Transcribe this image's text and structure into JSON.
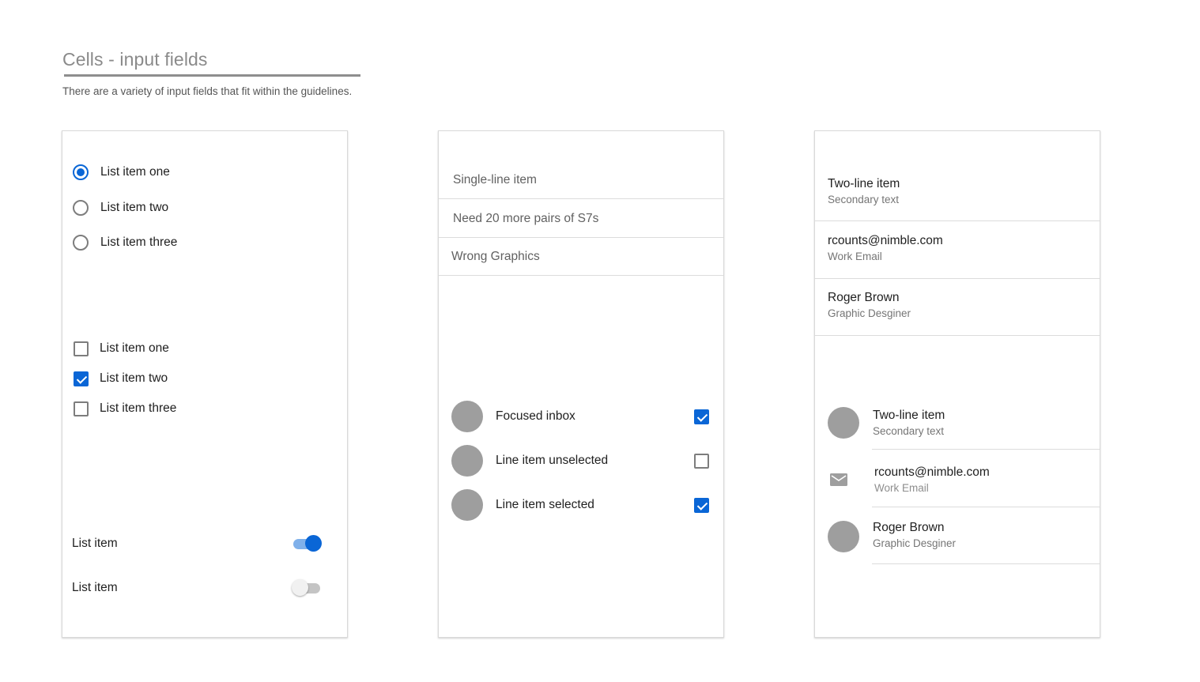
{
  "header": {
    "title": "Cells - input fields",
    "description": "There are a variety of input fields that fit within the guidelines."
  },
  "colors": {
    "accent": "#0a66d6",
    "avatar": "#9e9e9e",
    "divider": "#dcdcdc"
  },
  "card1": {
    "radios": [
      {
        "label": "List item one",
        "selected": true
      },
      {
        "label": "List item two",
        "selected": false
      },
      {
        "label": "List item three",
        "selected": false
      }
    ],
    "checkboxes": [
      {
        "label": "List item one",
        "checked": false
      },
      {
        "label": "List item two",
        "checked": true
      },
      {
        "label": "List item three",
        "checked": false
      }
    ],
    "toggles": [
      {
        "label": "List item",
        "on": true
      },
      {
        "label": "List item",
        "on": false
      }
    ]
  },
  "card2": {
    "single_line_items": [
      {
        "label": "Single-line item"
      },
      {
        "label": "Need 20 more pairs of S7s"
      },
      {
        "label": "Wrong Graphics"
      }
    ],
    "avatar_items": [
      {
        "label": "Focused inbox",
        "checked": true
      },
      {
        "label": "Line item unselected",
        "checked": false
      },
      {
        "label": "Line item selected",
        "checked": true
      }
    ]
  },
  "card3": {
    "two_line_items": [
      {
        "primary": "Two-line item",
        "secondary": "Secondary text"
      },
      {
        "primary": "rcounts@nimble.com",
        "secondary": "Work Email"
      },
      {
        "primary": "Roger Brown",
        "secondary": "Graphic Desginer"
      }
    ],
    "lead_items": [
      {
        "primary": "Two-line item",
        "secondary": "Secondary text",
        "lead": "avatar"
      },
      {
        "primary": "rcounts@nimble.com",
        "secondary": "Work Email",
        "lead": "mail-icon"
      },
      {
        "primary": "Roger Brown",
        "secondary": "Graphic Desginer",
        "lead": "avatar"
      }
    ]
  }
}
